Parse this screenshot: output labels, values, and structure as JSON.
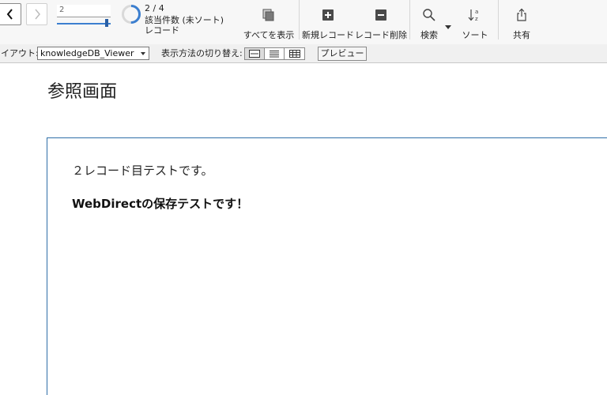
{
  "navigation": {
    "prev_icon": "chevron-left-icon",
    "next_icon": "chevron-right-icon",
    "record_input_value": "2",
    "record_slider_fraction": 0.95
  },
  "status": {
    "record_count": "2 / 4",
    "found_label": "該当件数 (未ソート)",
    "unit_label": "レコード",
    "ring_fraction": 0.5,
    "ring_color": "#3c7fd0"
  },
  "toolbar": {
    "show_all_label": "すべてを表示",
    "new_record_label": "新規レコード",
    "delete_record_label": "レコード削除",
    "find_label": "検索",
    "sort_label": "ソート",
    "share_label": "共有"
  },
  "layout_bar": {
    "layout_label": "レイアウト:",
    "layout_value": "knowledgeDB_Viewer",
    "view_as_label": "表示方法の切り替え:",
    "view_modes": [
      "form-view-icon",
      "list-view-icon",
      "table-view-icon"
    ],
    "active_view": "form-view-icon",
    "preview_label": "プレビュー"
  },
  "content": {
    "title": "参照画面",
    "body_line1": "２レコード目テストです。",
    "body_line2": "WebDirectの保存テストです！",
    "panel_border_color": "#2f6fa8"
  }
}
